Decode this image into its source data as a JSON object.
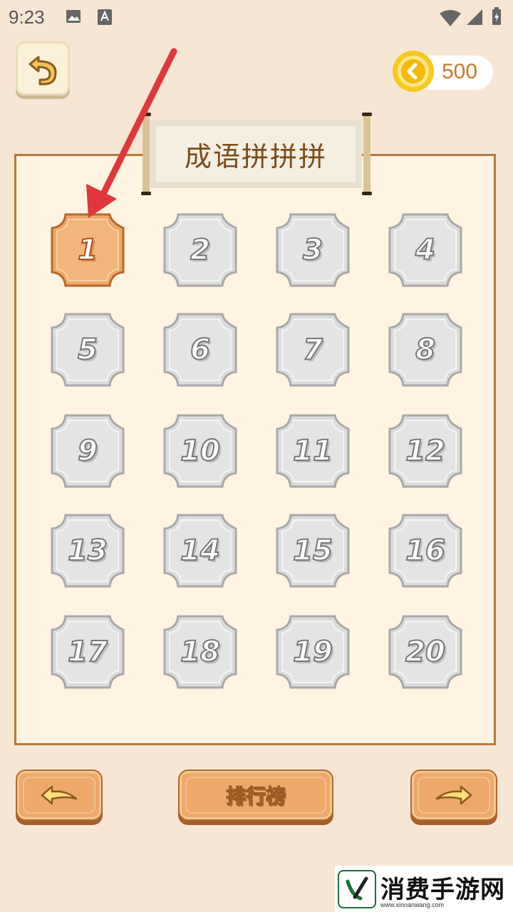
{
  "status_bar": {
    "time": "9:23",
    "icons": [
      "image-icon",
      "a-icon",
      "wifi-icon",
      "signal-icon",
      "battery-icon"
    ]
  },
  "coins": {
    "count": "500",
    "icon": "coin-icon"
  },
  "title": "成语拼拼拼",
  "levels": [
    {
      "label": "1",
      "state": "unlocked"
    },
    {
      "label": "2",
      "state": "locked"
    },
    {
      "label": "3",
      "state": "locked"
    },
    {
      "label": "4",
      "state": "locked"
    },
    {
      "label": "5",
      "state": "locked"
    },
    {
      "label": "6",
      "state": "locked"
    },
    {
      "label": "7",
      "state": "locked"
    },
    {
      "label": "8",
      "state": "locked"
    },
    {
      "label": "9",
      "state": "locked"
    },
    {
      "label": "10",
      "state": "locked"
    },
    {
      "label": "11",
      "state": "locked"
    },
    {
      "label": "12",
      "state": "locked"
    },
    {
      "label": "13",
      "state": "locked"
    },
    {
      "label": "14",
      "state": "locked"
    },
    {
      "label": "15",
      "state": "locked"
    },
    {
      "label": "16",
      "state": "locked"
    },
    {
      "label": "17",
      "state": "locked"
    },
    {
      "label": "18",
      "state": "locked"
    },
    {
      "label": "19",
      "state": "locked"
    },
    {
      "label": "20",
      "state": "locked"
    }
  ],
  "bottom": {
    "prev_icon": "arrow-left-icon",
    "rank_label": "排行榜",
    "next_icon": "arrow-right-icon"
  },
  "watermark": {
    "text": "消费手游网",
    "url": "www.xinnanwang.com"
  },
  "colors": {
    "background": "#f8e6d4",
    "panel": "#fff3e2",
    "panel_border": "#b57a3f",
    "active_tile": "#eda86a",
    "locked_tile": "#dcdcdc",
    "annotation_arrow": "#e0383a"
  }
}
